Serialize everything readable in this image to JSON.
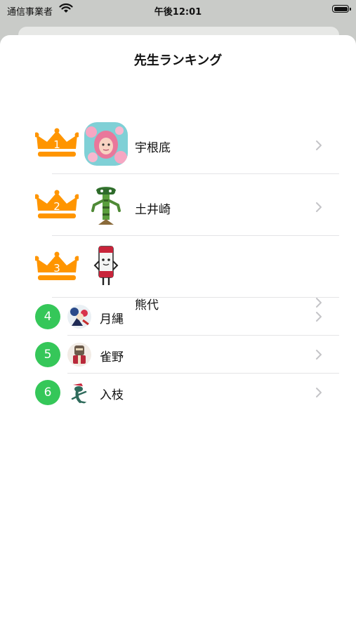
{
  "status_bar": {
    "carrier": "通信事業者",
    "time": "午後12:01"
  },
  "sheet": {
    "title": "先生ランキング"
  },
  "ranking": [
    {
      "rank": "1",
      "name": "宇根底",
      "style": "crown",
      "avatar_icon": "pink-creature-avatar-icon"
    },
    {
      "rank": "2",
      "name": "土井崎",
      "style": "crown",
      "avatar_icon": "green-totem-robot-avatar-icon"
    },
    {
      "rank": "3",
      "name": "熊代",
      "style": "crown",
      "avatar_icon": "boxy-character-avatar-icon"
    },
    {
      "rank": "4",
      "name": "月縄",
      "style": "badge",
      "avatar_icon": "cartoon-character-avatar-icon"
    },
    {
      "rank": "5",
      "name": "雀野",
      "style": "badge",
      "avatar_icon": "knight-character-avatar-icon"
    },
    {
      "rank": "6",
      "name": "入枝",
      "style": "badge",
      "avatar_icon": "lizard-character-avatar-icon"
    }
  ],
  "colors": {
    "crown": "#ff9500",
    "badge": "#34c759",
    "chevron": "#c4c4c7"
  }
}
